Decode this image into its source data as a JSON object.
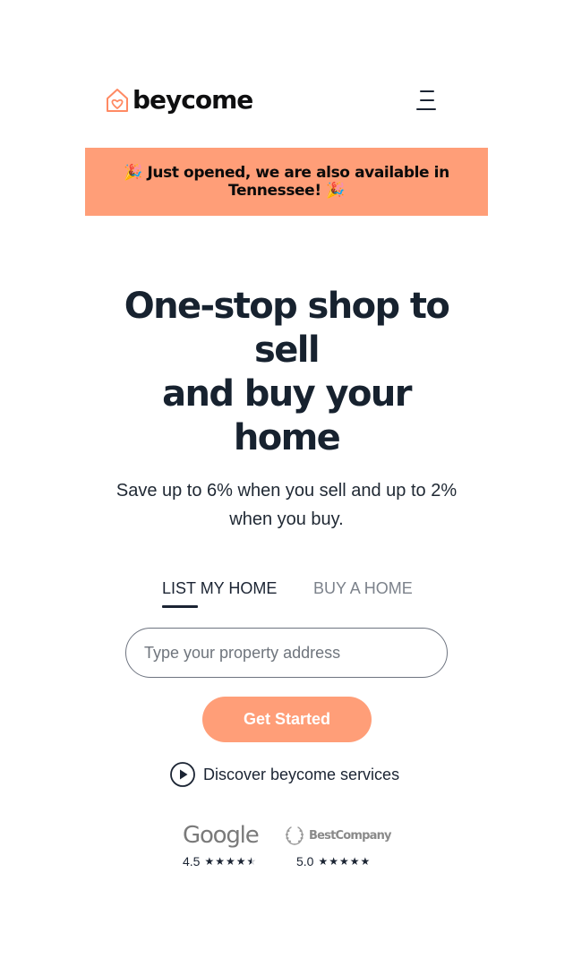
{
  "header": {
    "brand": "beycome",
    "menu_icon": "hamburger-menu-icon",
    "logo_icon": "house-heart-icon",
    "brand_color": "#ff9e78"
  },
  "banner": {
    "text": "Just opened, we are also available in Tennessee!",
    "emoji": "🎉",
    "background": "#ff9e78"
  },
  "hero": {
    "title_line1": "One-stop shop to sell",
    "title_line2": "and buy your home",
    "subtitle": "Save up to 6% when you sell and up to 2% when you buy."
  },
  "tabs": [
    {
      "label": "LIST MY HOME",
      "active": true
    },
    {
      "label": "BUY A HOME",
      "active": false
    }
  ],
  "search": {
    "placeholder": "Type your property address",
    "value": ""
  },
  "cta": {
    "label": "Get Started",
    "color": "#ff9e78"
  },
  "discover": {
    "label": "Discover beycome services",
    "icon": "play-circle-icon"
  },
  "ratings": [
    {
      "source": "Google",
      "score": "4.5",
      "stars": 4.5
    },
    {
      "source": "BestCompany",
      "score": "5.0",
      "stars": 5
    }
  ]
}
